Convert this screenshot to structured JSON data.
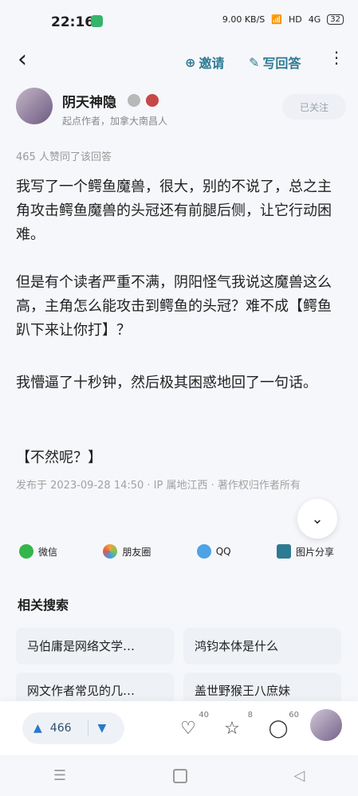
{
  "status_bar": {
    "time": "22:16",
    "network_speed": "9.00 KB/S",
    "hd": "HD",
    "signal": "4G",
    "battery": "32"
  },
  "header": {
    "back": "‹",
    "invite": "邀请",
    "write_answer": "写回答",
    "more": "⋮"
  },
  "author": {
    "name": "阴天神隐",
    "subtitle": "起点作者，加拿大南昌人",
    "follow_label": "已关注"
  },
  "answer": {
    "likes_text": "465 人赞同了该回答",
    "para1": "我写了一个鳄鱼魔兽，很大，别的不说了，总之主角攻击鳄鱼魔兽的头冠还有前腿后侧，让它行动困难。",
    "para2": "但是有个读者严重不满，阴阳怪气我说这魔兽这么高，主角怎么能攻击到鳄鱼的头冠？难不成【鳄鱼趴下来让你打】？",
    "para3": "我懵逼了十秒钟，然后极其困惑地回了一句话。",
    "para4": "【不然呢？】",
    "meta": "发布于 2023-09-28 14:50 · IP 属地江西 · 著作权归作者所有"
  },
  "share": {
    "wechat": "微信",
    "moments": "朋友圈",
    "qq": "QQ",
    "image_share": "图片分享"
  },
  "related": {
    "title": "相关搜索",
    "items": [
      "马伯庸是网络文学…",
      "鸿钧本体是什么",
      "网文作者常见的几…",
      "盖世野猴王八庶妹"
    ]
  },
  "bottom_bar": {
    "vote_count": "466",
    "likes": "40",
    "favorites": "8",
    "comments": "60"
  },
  "icons": {
    "invite": "add-person-icon",
    "write": "edit-icon",
    "heart": "heart-icon",
    "star": "star-icon",
    "comment": "comment-icon"
  }
}
